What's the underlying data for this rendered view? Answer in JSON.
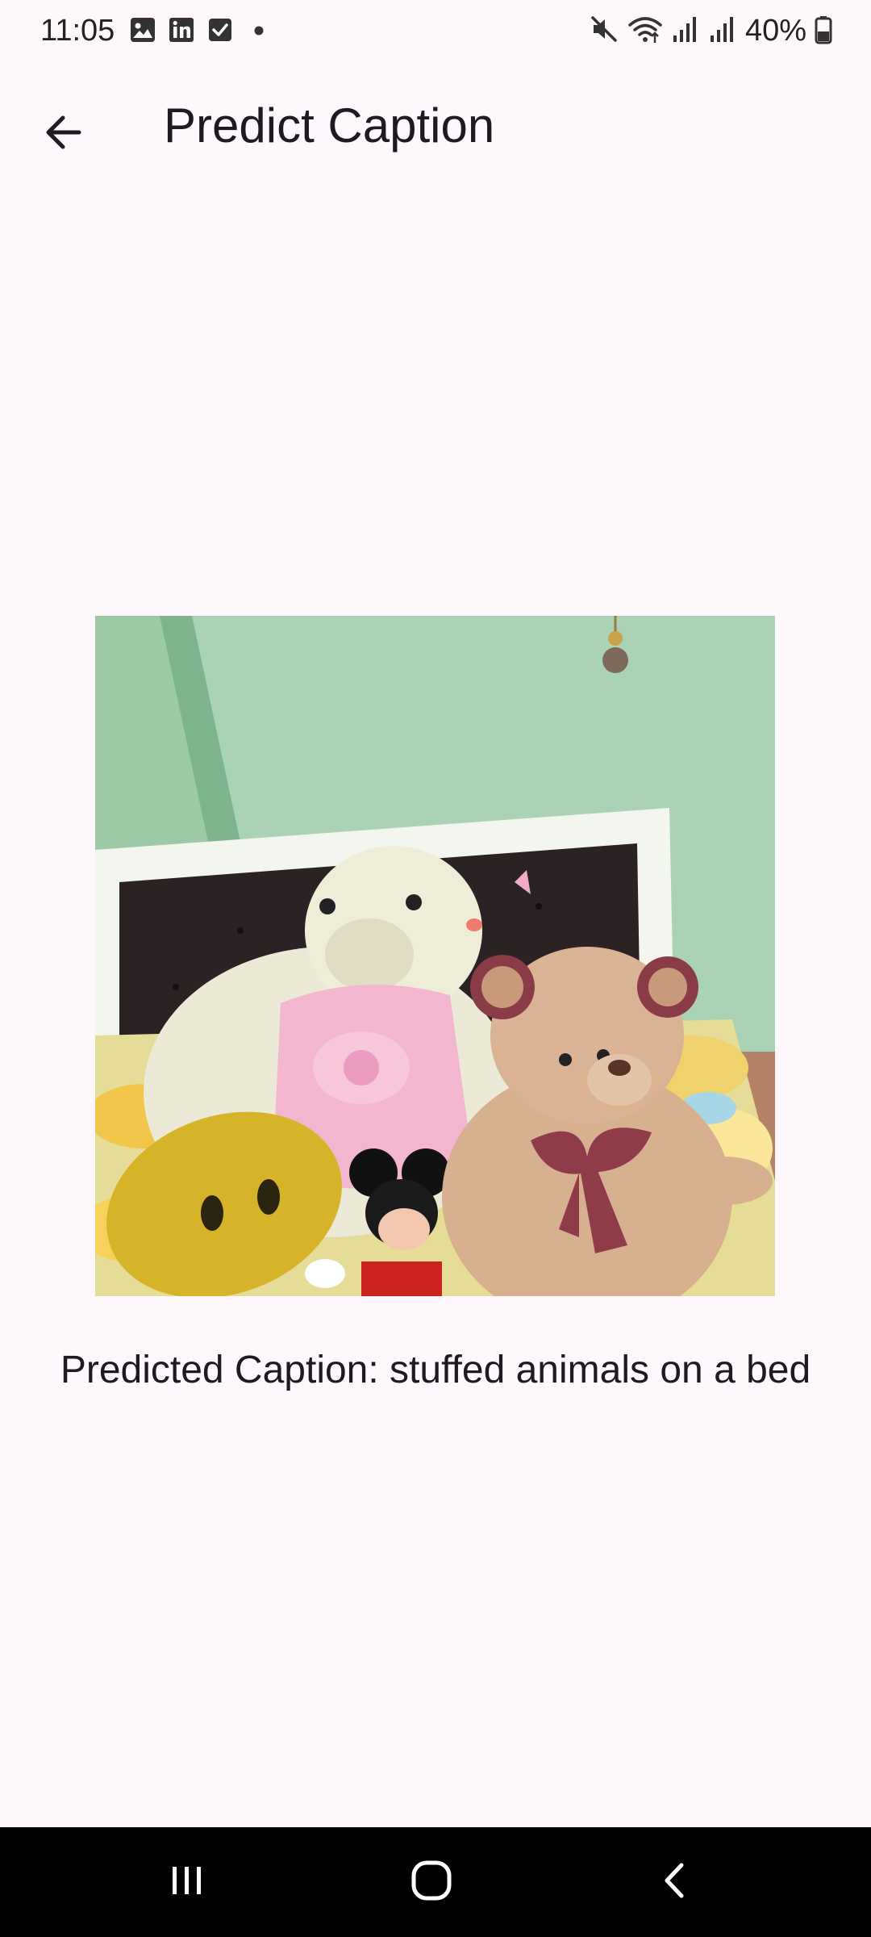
{
  "status_bar": {
    "time": "11:05",
    "notification_icons": [
      "gallery-icon",
      "linkedin-icon",
      "checkbox-icon",
      "dot-icon"
    ],
    "system_icons": [
      "mute-icon",
      "wifi-icon",
      "signal-icon",
      "signal-icon",
      "battery-icon"
    ],
    "battery": "40%"
  },
  "app_bar": {
    "title": "Predict Caption",
    "back_icon": "arrow-back-icon"
  },
  "main": {
    "image": {
      "description_icon": "photo"
    },
    "caption": "Predicted Caption: stuffed animals on a bed"
  },
  "nav_bar": {
    "buttons": [
      "recent-apps-icon",
      "home-icon",
      "back-icon"
    ]
  }
}
